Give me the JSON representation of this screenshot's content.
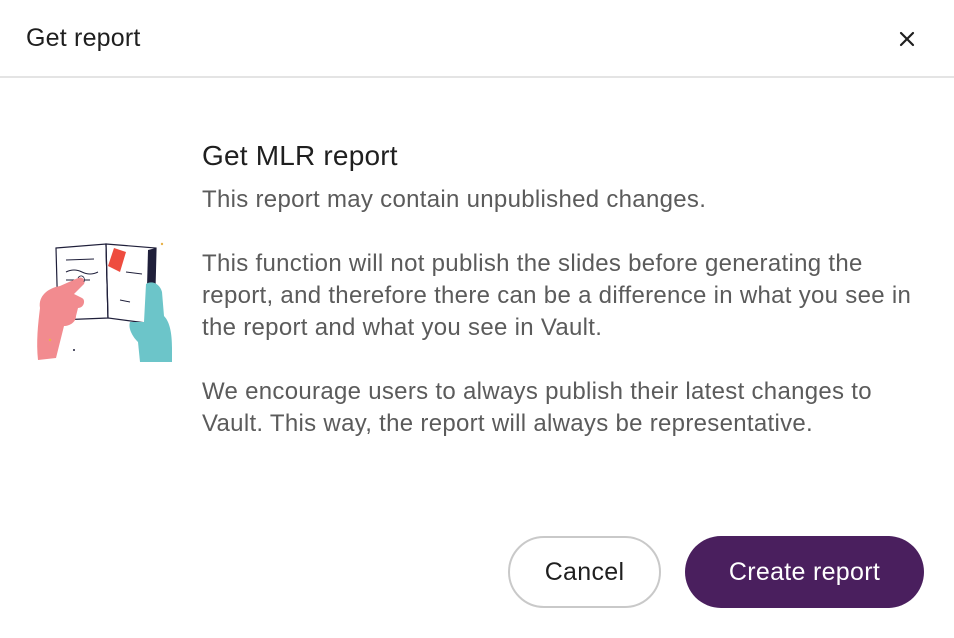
{
  "dialog": {
    "title": "Get report",
    "close_icon": "close-icon"
  },
  "content": {
    "heading": "Get MLR report",
    "paragraphs": [
      "This report may contain unpublished changes.",
      "This function will not publish the slides before generating the report, and therefore there can be a difference in what you see in the report and what you see in Vault.",
      "We encourage users to always publish their latest changes to Vault. This way, the report will always be representative."
    ],
    "illustration_icon": "hands-holding-document-illustration"
  },
  "actions": {
    "cancel_label": "Cancel",
    "create_label": "Create report"
  },
  "colors": {
    "primary": "#4a1f5e",
    "text_dark": "#1f1f1f",
    "text_body": "#5b5b5b",
    "divider": "#e4e4e4",
    "accent_red": "#ee4c3f",
    "accent_pink": "#f28b8f",
    "accent_teal": "#6cc5c9"
  }
}
